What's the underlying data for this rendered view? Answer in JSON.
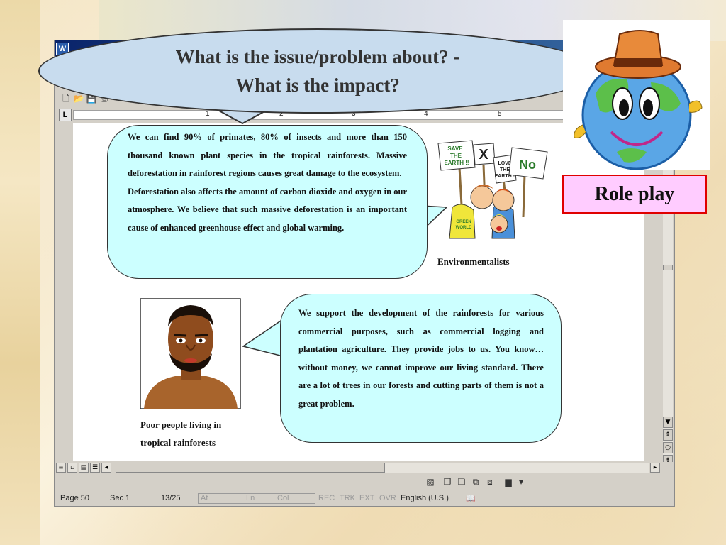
{
  "question": {
    "line1": "What is the issue/problem about? -",
    "line2": "What is the impact?"
  },
  "role_play": {
    "label": "Role play"
  },
  "ruler": {
    "numbers": [
      "1",
      "2",
      "3",
      "4",
      "5"
    ]
  },
  "environmentalists": {
    "paragraph1": "We can find 90% of primates, 80% of insects and more than 150 thousand known plant species in the tropical rainforests. Massive deforestation in rainforest regions causes great damage to the ecosystem.",
    "paragraph2": "Deforestation also affects the amount of carbon dioxide and oxygen in our atmosphere. We believe that such massive deforestation is an important cause of enhanced greenhouse effect and global warming.",
    "caption": "Environmentalists",
    "signs": {
      "sign1": "SAVE THE EARTH !!",
      "sign2": "LOVE THE EARTH !!",
      "sign3": "No",
      "shirt": "GREEN WORLD"
    }
  },
  "poor_people": {
    "paragraph": "We support the development of the rainforests for various commercial purposes, such as commercial logging and plantation agriculture. They provide jobs to us. You know… without money, we cannot improve our living standard. There are a lot of trees in our forests and cutting parts of them is not a great problem.",
    "caption_line1": "Poor people living in",
    "caption_line2": "tropical rainforests"
  },
  "status_bar": {
    "page": "Page 50",
    "sec": "Sec 1",
    "pages": "13/25",
    "at": "At",
    "ln": "Ln",
    "col": "Col",
    "rec": "REC",
    "trk": "TRK",
    "ext": "EXT",
    "ovr": "OVR",
    "language": "English (U.S.)"
  },
  "icons": {
    "app": "word-icon",
    "new": "new-document-icon",
    "open": "open-folder-icon",
    "save": "save-disk-icon"
  }
}
